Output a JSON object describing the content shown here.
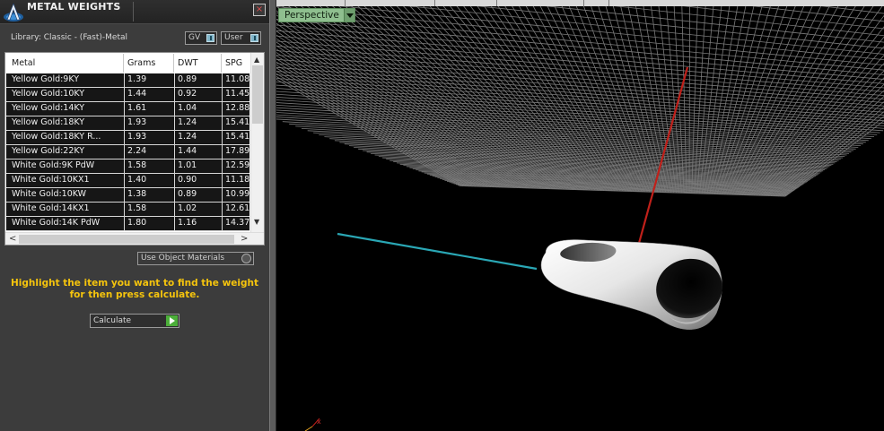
{
  "panel": {
    "title": "METAL WEIGHTS",
    "close_glyph": "×",
    "library_label": "Library: Classic - (Fast)-Metal",
    "gv_label": "GV",
    "user_label": "User",
    "columns": [
      "Metal",
      "Grams",
      "DWT",
      "SPG"
    ],
    "rows": [
      {
        "metal": "Yellow Gold:9KY",
        "grams": "1.39",
        "dwt": "0.89",
        "spg": "11.08"
      },
      {
        "metal": "Yellow Gold:10KY",
        "grams": "1.44",
        "dwt": "0.92",
        "spg": "11.45"
      },
      {
        "metal": "Yellow Gold:14KY",
        "grams": "1.61",
        "dwt": "1.04",
        "spg": "12.88"
      },
      {
        "metal": "Yellow Gold:18KY",
        "grams": "1.93",
        "dwt": "1.24",
        "spg": "15.41"
      },
      {
        "metal": "Yellow Gold:18KY R...",
        "grams": "1.93",
        "dwt": "1.24",
        "spg": "15.41"
      },
      {
        "metal": "Yellow Gold:22KY",
        "grams": "2.24",
        "dwt": "1.44",
        "spg": "17.89"
      },
      {
        "metal": "White Gold:9K PdW",
        "grams": "1.58",
        "dwt": "1.01",
        "spg": "12.59"
      },
      {
        "metal": "White Gold:10KX1",
        "grams": "1.40",
        "dwt": "0.90",
        "spg": "11.18"
      },
      {
        "metal": "White Gold:10KW",
        "grams": "1.38",
        "dwt": "0.89",
        "spg": "10.99"
      },
      {
        "metal": "White Gold:14KX1",
        "grams": "1.58",
        "dwt": "1.02",
        "spg": "12.61"
      },
      {
        "metal": "White Gold:14K PdW",
        "grams": "1.80",
        "dwt": "1.16",
        "spg": "14.37"
      }
    ],
    "scroll_up_glyph": "▲",
    "scroll_down_glyph": "▼",
    "scroll_left_glyph": "<",
    "scroll_right_glyph": ">",
    "use_object_materials_label": "Use Object Materials",
    "hint_text": "Highlight the item you want to find the weight for then press calculate.",
    "calculate_label": "Calculate"
  },
  "viewport": {
    "view_mode": "Perspective"
  },
  "icons": {
    "logo": "app-logo-icon",
    "close": "close-icon",
    "go": "play-arrow-icon"
  },
  "colors": {
    "x_axis": "#2aa7b5",
    "y_axis": "#c0201a",
    "grid": "#7a7a7a",
    "hint": "#f5c40d",
    "view_select": "#8fbf8f"
  }
}
